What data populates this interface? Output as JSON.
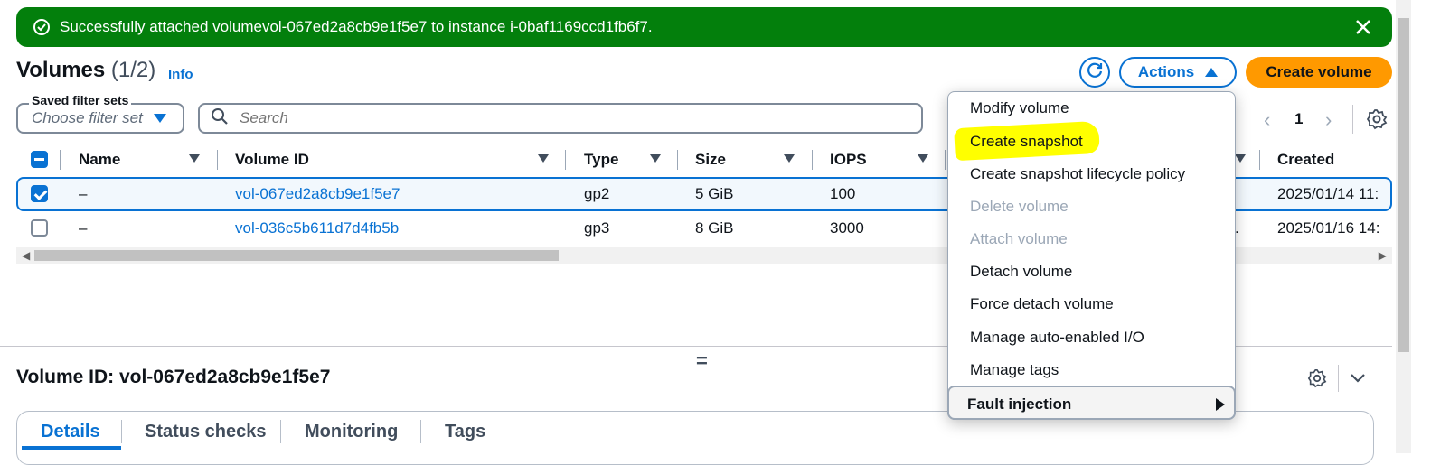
{
  "flash": {
    "prefix": "Successfully attached volume ",
    "volume_link": "vol-067ed2a8cb9e1f5e7",
    "middle": " to instance ",
    "instance_link": "i-0baf1169ccd1fb6f7",
    "suffix": ".",
    "color": "#037f0c"
  },
  "header": {
    "title": "Volumes",
    "count": "(1/2)",
    "info": "Info",
    "actions_label": "Actions",
    "create_label": "Create volume"
  },
  "filters": {
    "saved_legend": "Saved filter sets",
    "saved_placeholder": "Choose filter set",
    "search_placeholder": "Search"
  },
  "pagination": {
    "prev": "‹",
    "page": "1",
    "next": "›"
  },
  "table": {
    "columns": [
      "Name",
      "Volume ID",
      "Type",
      "Size",
      "IOPS",
      "Created"
    ],
    "rows": [
      {
        "name": "–",
        "volume_id": "vol-067ed2a8cb9e1f5e7",
        "type": "gp2",
        "size": "5 GiB",
        "iops": "100",
        "partial": "",
        "created": "2025/01/14 11:",
        "selected": true
      },
      {
        "name": "–",
        "volume_id": "vol-036c5b611d7d4fb5b",
        "type": "gp3",
        "size": "8 GiB",
        "iops": "3000",
        "partial": ".",
        "created": "2025/01/16 14:",
        "selected": false
      }
    ]
  },
  "menu": {
    "items": [
      {
        "label": "Modify volume",
        "enabled": true
      },
      {
        "label": "Create snapshot",
        "enabled": true,
        "highlighted": true
      },
      {
        "label": "Create snapshot lifecycle policy",
        "enabled": true
      },
      {
        "label": "Delete volume",
        "enabled": false
      },
      {
        "label": "Attach volume",
        "enabled": false
      },
      {
        "label": "Detach volume",
        "enabled": true
      },
      {
        "label": "Force detach volume",
        "enabled": true
      },
      {
        "label": "Manage auto-enabled I/O",
        "enabled": true
      },
      {
        "label": "Manage tags",
        "enabled": true
      }
    ],
    "group": "Fault injection"
  },
  "detail": {
    "title": "Volume ID: vol-067ed2a8cb9e1f5e7",
    "handle": "=",
    "tabs": [
      "Details",
      "Status checks",
      "Monitoring",
      "Tags"
    ]
  },
  "colors": {
    "accent": "#0972d3",
    "primary_button": "#ff9900",
    "highlight": "#ffff00"
  },
  "icons": [
    "check-circle-icon",
    "close-icon",
    "refresh-icon",
    "caret-up-icon",
    "caret-down-icon",
    "search-icon",
    "settings-icon",
    "chevron-down-icon",
    "sort-icon"
  ]
}
